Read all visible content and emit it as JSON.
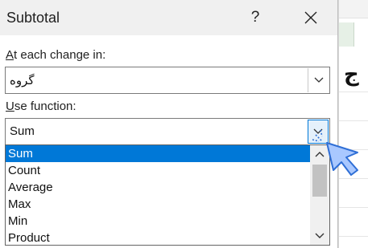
{
  "dialog": {
    "title": "Subtotal",
    "help_label": "?",
    "at_each_change_label_mnemonic": "A",
    "at_each_change_label_rest": "t each change in:",
    "at_each_change_value": "گروه",
    "use_function_label_mnemonic": "U",
    "use_function_label_rest": "se function:",
    "use_function_value": "Sum",
    "function_options": [
      "Sum",
      "Count",
      "Average",
      "Max",
      "Min",
      "Product"
    ],
    "selected_function": "Sum"
  },
  "background_sheet": {
    "visible_glyph": "ج"
  },
  "colors": {
    "selection": "#0078d7",
    "dialog_titlebar": "#f0f0f0",
    "cursor_fill": "#a9c8ff",
    "cursor_outline": "#2f6fd6"
  },
  "icons": {
    "close": "close-icon",
    "dropdown": "chevron-down-icon",
    "scroll_up": "chevron-up-icon",
    "scroll_down": "chevron-down-icon",
    "pointer": "mouse-pointer-icon"
  }
}
